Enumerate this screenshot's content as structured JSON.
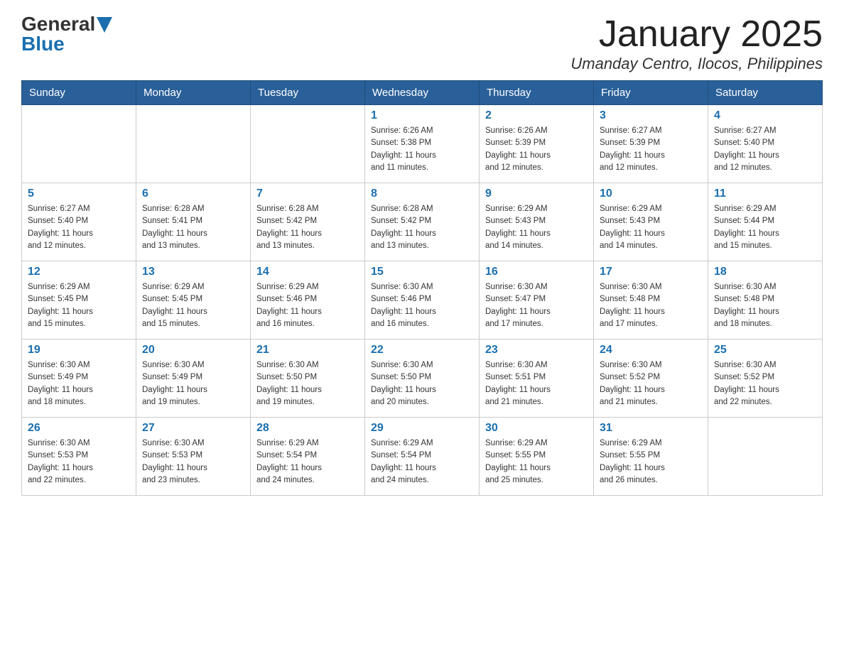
{
  "header": {
    "logo_general": "General",
    "logo_blue": "Blue",
    "month_title": "January 2025",
    "location": "Umanday Centro, Ilocos, Philippines"
  },
  "days_of_week": [
    "Sunday",
    "Monday",
    "Tuesday",
    "Wednesday",
    "Thursday",
    "Friday",
    "Saturday"
  ],
  "weeks": [
    [
      {
        "day": "",
        "info": ""
      },
      {
        "day": "",
        "info": ""
      },
      {
        "day": "",
        "info": ""
      },
      {
        "day": "1",
        "info": "Sunrise: 6:26 AM\nSunset: 5:38 PM\nDaylight: 11 hours\nand 11 minutes."
      },
      {
        "day": "2",
        "info": "Sunrise: 6:26 AM\nSunset: 5:39 PM\nDaylight: 11 hours\nand 12 minutes."
      },
      {
        "day": "3",
        "info": "Sunrise: 6:27 AM\nSunset: 5:39 PM\nDaylight: 11 hours\nand 12 minutes."
      },
      {
        "day": "4",
        "info": "Sunrise: 6:27 AM\nSunset: 5:40 PM\nDaylight: 11 hours\nand 12 minutes."
      }
    ],
    [
      {
        "day": "5",
        "info": "Sunrise: 6:27 AM\nSunset: 5:40 PM\nDaylight: 11 hours\nand 12 minutes."
      },
      {
        "day": "6",
        "info": "Sunrise: 6:28 AM\nSunset: 5:41 PM\nDaylight: 11 hours\nand 13 minutes."
      },
      {
        "day": "7",
        "info": "Sunrise: 6:28 AM\nSunset: 5:42 PM\nDaylight: 11 hours\nand 13 minutes."
      },
      {
        "day": "8",
        "info": "Sunrise: 6:28 AM\nSunset: 5:42 PM\nDaylight: 11 hours\nand 13 minutes."
      },
      {
        "day": "9",
        "info": "Sunrise: 6:29 AM\nSunset: 5:43 PM\nDaylight: 11 hours\nand 14 minutes."
      },
      {
        "day": "10",
        "info": "Sunrise: 6:29 AM\nSunset: 5:43 PM\nDaylight: 11 hours\nand 14 minutes."
      },
      {
        "day": "11",
        "info": "Sunrise: 6:29 AM\nSunset: 5:44 PM\nDaylight: 11 hours\nand 15 minutes."
      }
    ],
    [
      {
        "day": "12",
        "info": "Sunrise: 6:29 AM\nSunset: 5:45 PM\nDaylight: 11 hours\nand 15 minutes."
      },
      {
        "day": "13",
        "info": "Sunrise: 6:29 AM\nSunset: 5:45 PM\nDaylight: 11 hours\nand 15 minutes."
      },
      {
        "day": "14",
        "info": "Sunrise: 6:29 AM\nSunset: 5:46 PM\nDaylight: 11 hours\nand 16 minutes."
      },
      {
        "day": "15",
        "info": "Sunrise: 6:30 AM\nSunset: 5:46 PM\nDaylight: 11 hours\nand 16 minutes."
      },
      {
        "day": "16",
        "info": "Sunrise: 6:30 AM\nSunset: 5:47 PM\nDaylight: 11 hours\nand 17 minutes."
      },
      {
        "day": "17",
        "info": "Sunrise: 6:30 AM\nSunset: 5:48 PM\nDaylight: 11 hours\nand 17 minutes."
      },
      {
        "day": "18",
        "info": "Sunrise: 6:30 AM\nSunset: 5:48 PM\nDaylight: 11 hours\nand 18 minutes."
      }
    ],
    [
      {
        "day": "19",
        "info": "Sunrise: 6:30 AM\nSunset: 5:49 PM\nDaylight: 11 hours\nand 18 minutes."
      },
      {
        "day": "20",
        "info": "Sunrise: 6:30 AM\nSunset: 5:49 PM\nDaylight: 11 hours\nand 19 minutes."
      },
      {
        "day": "21",
        "info": "Sunrise: 6:30 AM\nSunset: 5:50 PM\nDaylight: 11 hours\nand 19 minutes."
      },
      {
        "day": "22",
        "info": "Sunrise: 6:30 AM\nSunset: 5:50 PM\nDaylight: 11 hours\nand 20 minutes."
      },
      {
        "day": "23",
        "info": "Sunrise: 6:30 AM\nSunset: 5:51 PM\nDaylight: 11 hours\nand 21 minutes."
      },
      {
        "day": "24",
        "info": "Sunrise: 6:30 AM\nSunset: 5:52 PM\nDaylight: 11 hours\nand 21 minutes."
      },
      {
        "day": "25",
        "info": "Sunrise: 6:30 AM\nSunset: 5:52 PM\nDaylight: 11 hours\nand 22 minutes."
      }
    ],
    [
      {
        "day": "26",
        "info": "Sunrise: 6:30 AM\nSunset: 5:53 PM\nDaylight: 11 hours\nand 22 minutes."
      },
      {
        "day": "27",
        "info": "Sunrise: 6:30 AM\nSunset: 5:53 PM\nDaylight: 11 hours\nand 23 minutes."
      },
      {
        "day": "28",
        "info": "Sunrise: 6:29 AM\nSunset: 5:54 PM\nDaylight: 11 hours\nand 24 minutes."
      },
      {
        "day": "29",
        "info": "Sunrise: 6:29 AM\nSunset: 5:54 PM\nDaylight: 11 hours\nand 24 minutes."
      },
      {
        "day": "30",
        "info": "Sunrise: 6:29 AM\nSunset: 5:55 PM\nDaylight: 11 hours\nand 25 minutes."
      },
      {
        "day": "31",
        "info": "Sunrise: 6:29 AM\nSunset: 5:55 PM\nDaylight: 11 hours\nand 26 minutes."
      },
      {
        "day": "",
        "info": ""
      }
    ]
  ]
}
